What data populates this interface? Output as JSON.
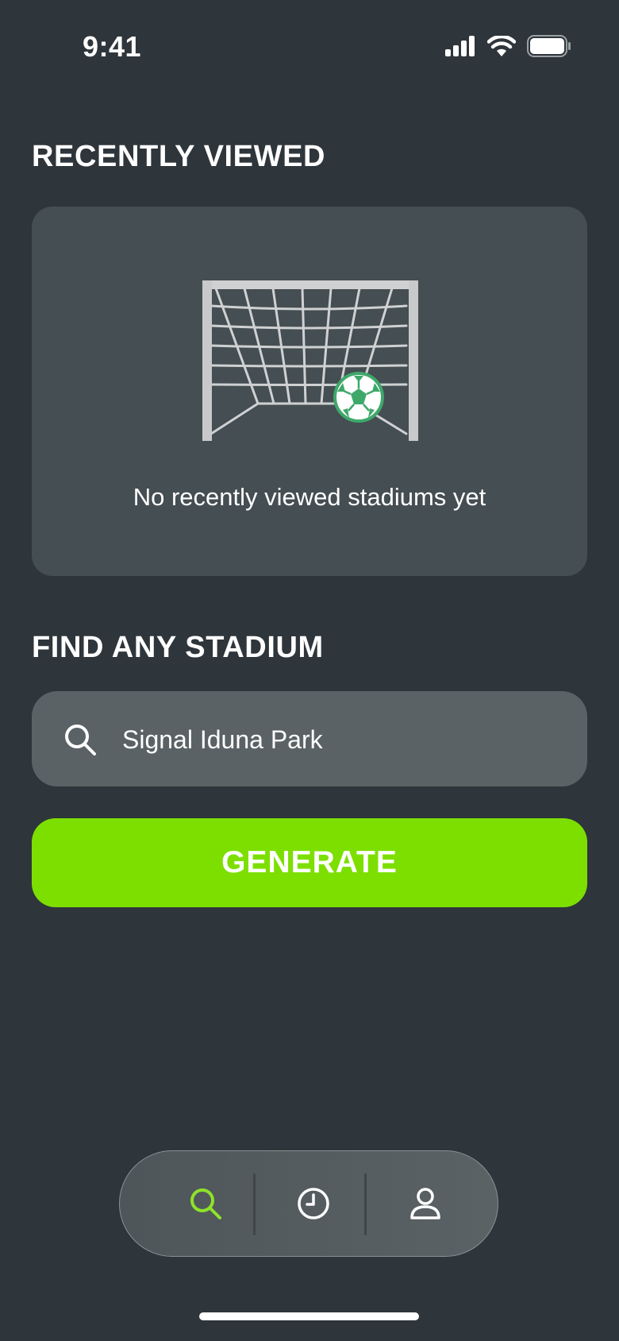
{
  "status_bar": {
    "time": "9:41"
  },
  "recently_viewed": {
    "title": "RECENTLY VIEWED",
    "empty_message": "No recently viewed stadiums yet"
  },
  "find_stadium": {
    "title": "FIND ANY STADIUM",
    "search_value": "Signal Iduna Park",
    "search_icon": "search-icon"
  },
  "generate_button": {
    "label": "GENERATE"
  },
  "tab_bar": {
    "tabs": [
      {
        "icon": "search-icon",
        "active": true
      },
      {
        "icon": "clock-icon",
        "active": false
      },
      {
        "icon": "user-icon",
        "active": false
      }
    ]
  },
  "colors": {
    "background": "#2e353b",
    "card": "#454e52",
    "input": "#5a6265",
    "accent": "#7ddf00",
    "active_tab_icon": "#8ee22a"
  }
}
